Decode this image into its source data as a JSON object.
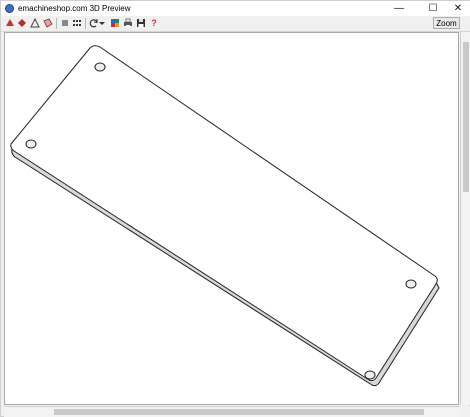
{
  "window": {
    "title": "emachineshop.com 3D Preview"
  },
  "window_controls": {
    "minimize": "—",
    "maximize": "☐",
    "close": "✕"
  },
  "toolbar": {
    "zoom_label": "Zoom",
    "buttons": [
      {
        "icon": "red-cube-icon"
      },
      {
        "icon": "red-diamond-icon"
      },
      {
        "icon": "triangle-outline-icon"
      },
      {
        "icon": "perspective-icon"
      },
      {
        "icon": "shaded-box-icon"
      },
      {
        "icon": "rotate-icon"
      },
      {
        "icon": "dropdown-arrow-icon"
      },
      {
        "icon": "color-palette-icon"
      },
      {
        "icon": "print-icon"
      },
      {
        "icon": "save-icon"
      },
      {
        "icon": "help-icon"
      }
    ],
    "colors": {
      "accent_red": "#c0392b",
      "help_red": "#d32f2f"
    }
  },
  "viewport": {
    "background": "#ffffff",
    "model": "rectangular plate with four mounting holes"
  }
}
